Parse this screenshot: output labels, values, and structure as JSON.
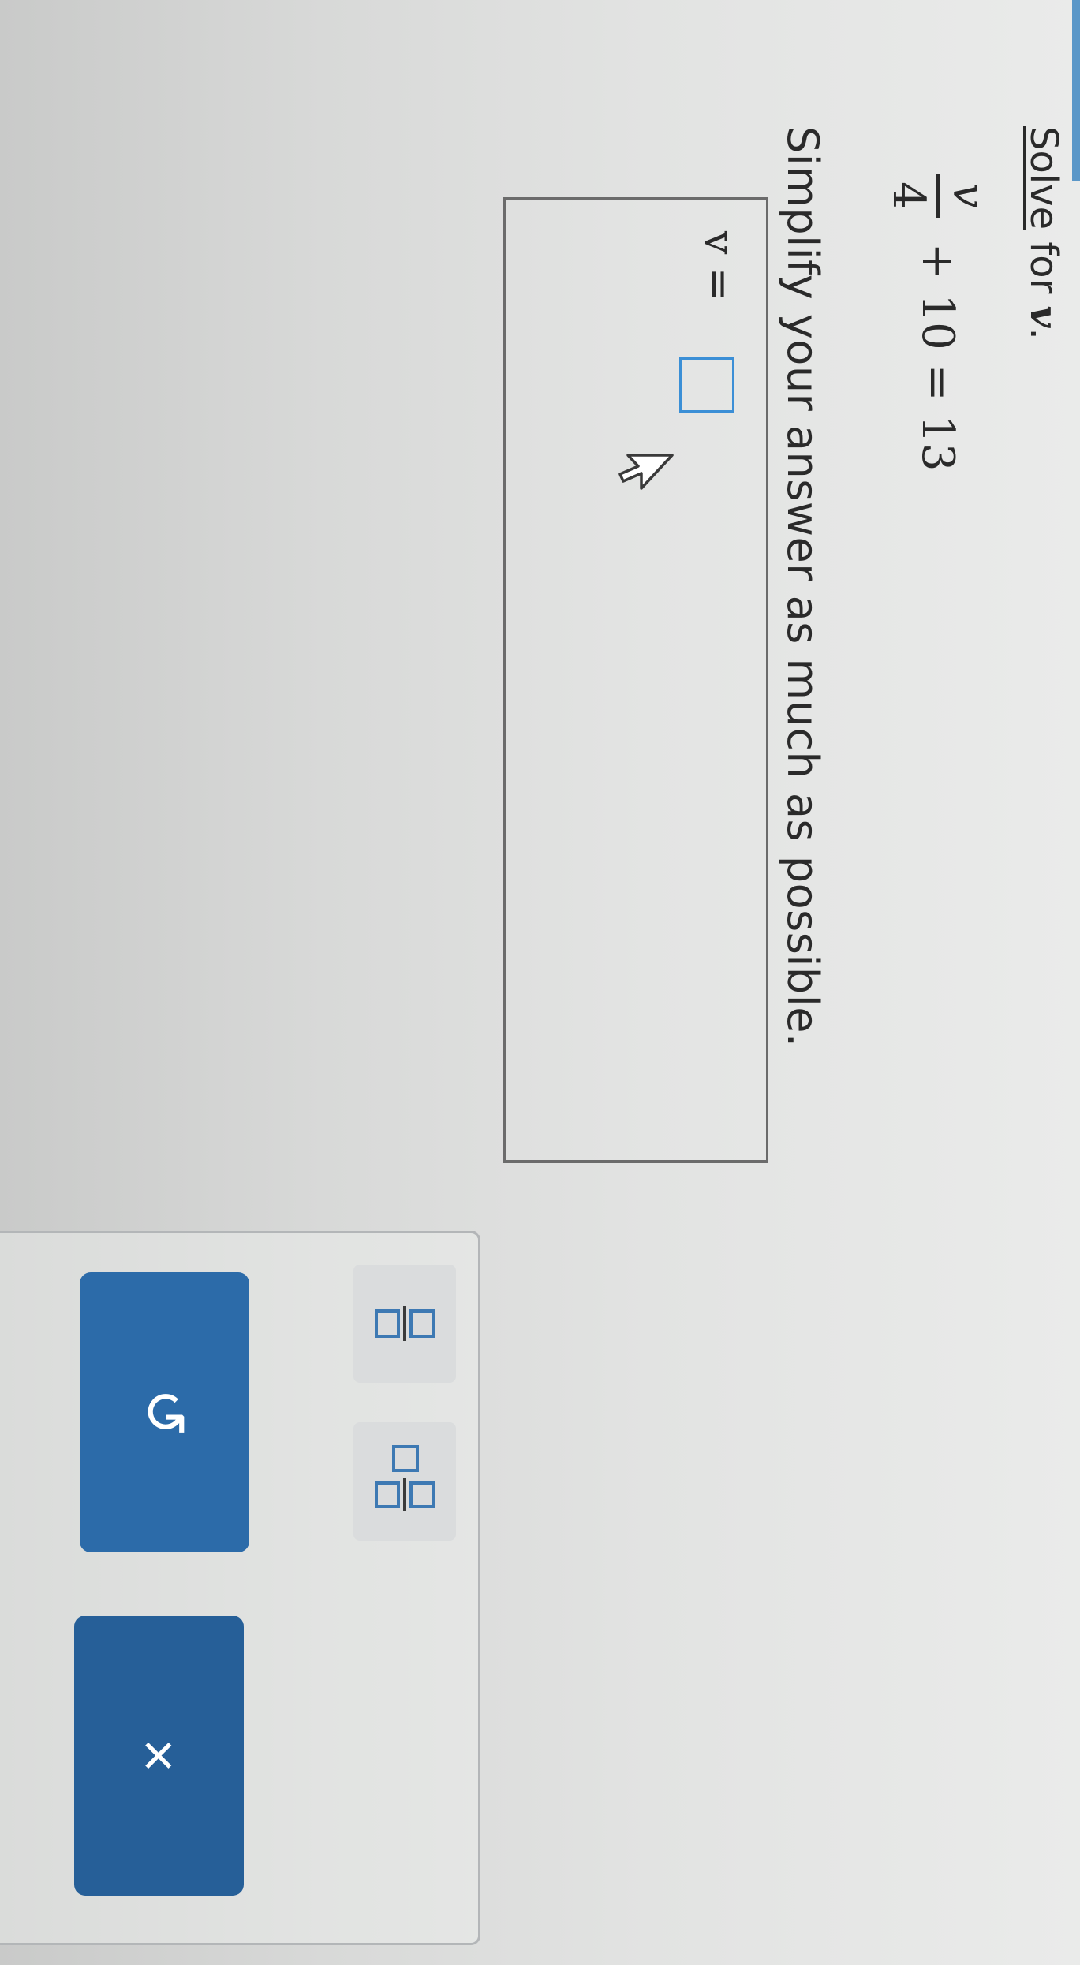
{
  "prompt": {
    "solve_word": "Solve",
    "solve_rest": " for ",
    "variable": "v",
    "period": "."
  },
  "equation": {
    "numerator": "v",
    "denominator": "4",
    "rest": " + 10 = 13"
  },
  "instruction": "Simplify your answer as much as possible.",
  "answer": {
    "prefix": "v =",
    "value": ""
  },
  "toolbar": {
    "fraction_icon": "fraction-icon",
    "mixed_number_icon": "mixed-number-icon"
  },
  "actions": {
    "undo_glyph": "↺",
    "clear_glyph": "×"
  },
  "colors": {
    "accent": "#2a6aa8",
    "input_border": "#3b8fd6"
  }
}
